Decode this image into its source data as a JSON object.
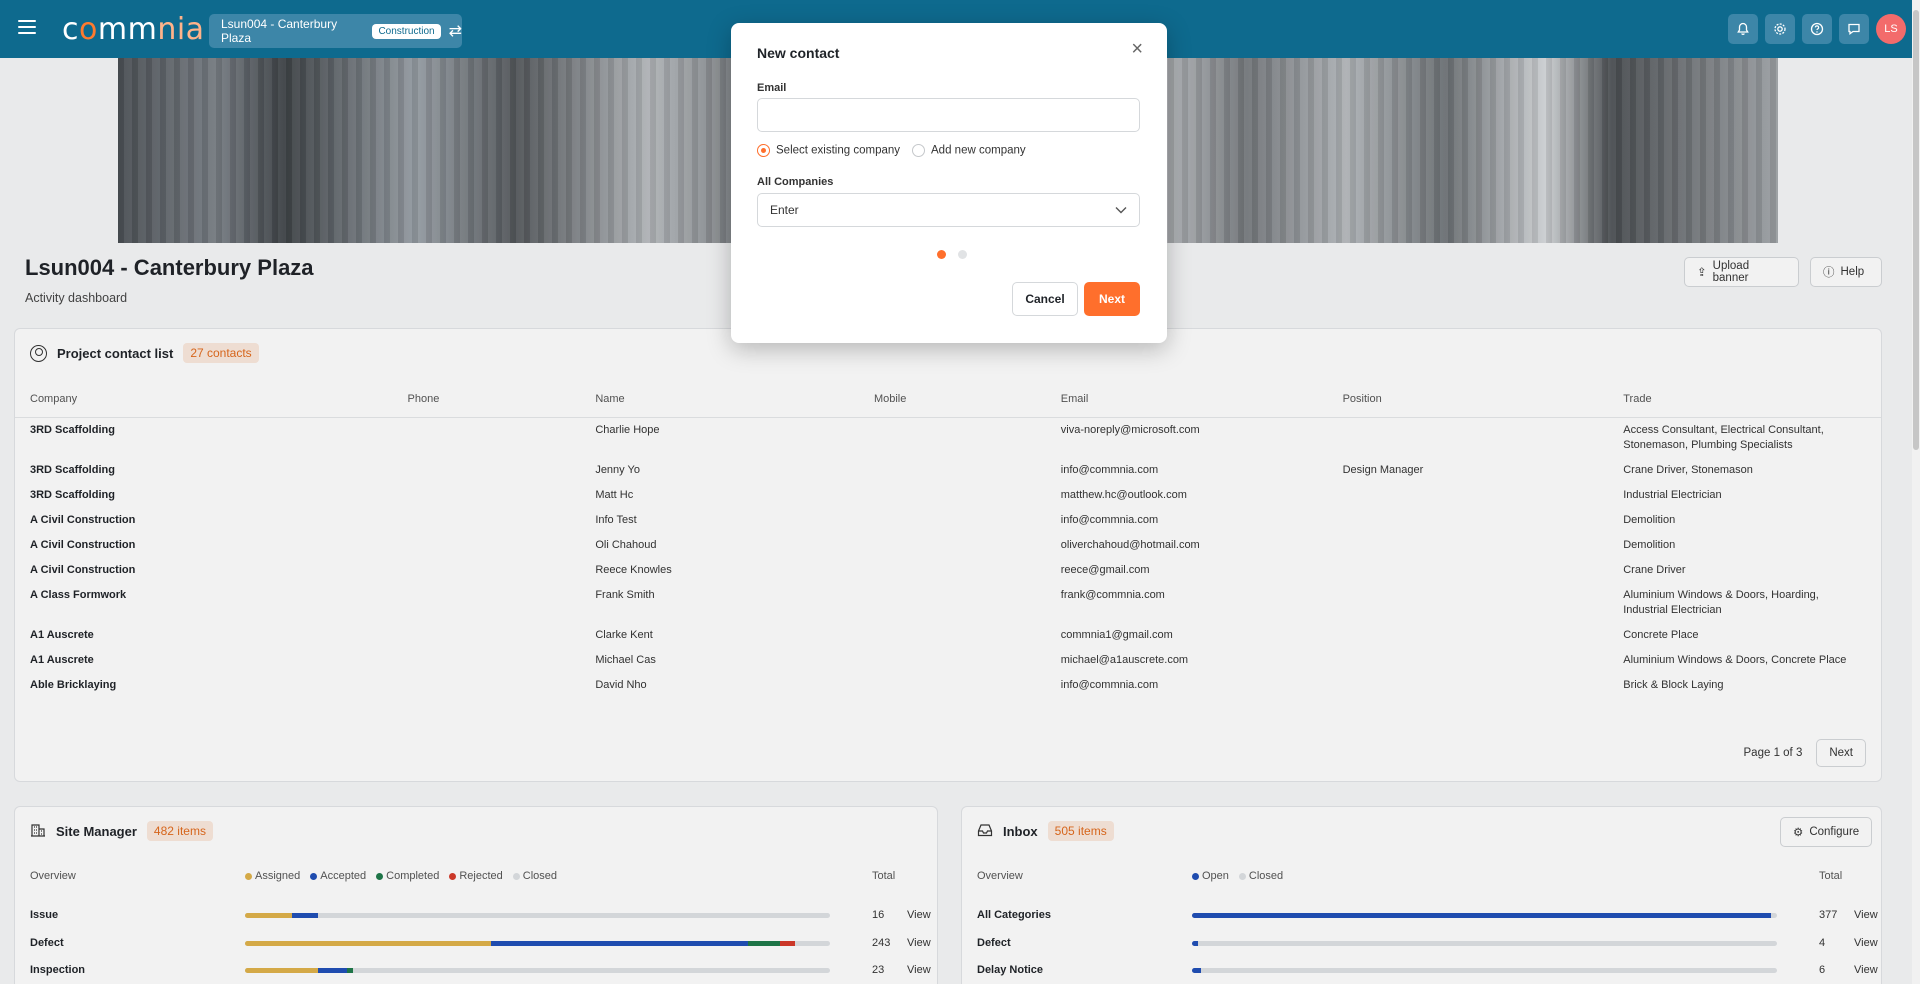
{
  "app": {
    "logo_text_c": "c",
    "logo_text_o": "o",
    "logo_text_mm": "mm",
    "logo_text_nia": "nia",
    "project_name": "Lsun004 - Canterbury Plaza",
    "project_badge": "Construction",
    "avatar_initials": "LS"
  },
  "colors": {
    "topbar": "#0e6a8e",
    "accent": "#ff6f2c"
  },
  "header": {
    "title": "Lsun004 - Canterbury Plaza",
    "subtitle": "Activity dashboard",
    "upload_banner": "Upload banner",
    "help": "Help"
  },
  "contacts": {
    "title": "Project contact list",
    "count": "27 contacts",
    "columns": [
      "Company",
      "Phone",
      "Name",
      "Mobile",
      "Email",
      "Position",
      "Trade"
    ],
    "rows": [
      [
        "3RD Scaffolding",
        "",
        "Charlie Hope",
        "",
        "viva-noreply@microsoft.com",
        "",
        "Access Consultant, Electrical Consultant, Stonemason, Plumbing Specialists"
      ],
      [
        "3RD Scaffolding",
        "",
        "Jenny Yo",
        "",
        "info@commnia.com",
        "Design Manager",
        "Crane Driver, Stonemason"
      ],
      [
        "3RD Scaffolding",
        "",
        "Matt Hc",
        "",
        "matthew.hc@outlook.com",
        "",
        "Industrial Electrician"
      ],
      [
        "A Civil Construction",
        "",
        "Info Test",
        "",
        "info@commnia.com",
        "",
        "Demolition"
      ],
      [
        "A Civil Construction",
        "",
        "Oli Chahoud",
        "",
        "oliverchahoud@hotmail.com",
        "",
        "Demolition"
      ],
      [
        "A Civil Construction",
        "",
        "Reece Knowles",
        "",
        "reece@gmail.com",
        "",
        "Crane Driver"
      ],
      [
        "A Class Formwork",
        "",
        "Frank Smith",
        "",
        "frank@commnia.com",
        "",
        "Aluminium Windows & Doors, Hoarding, Industrial Electrician"
      ],
      [
        "A1 Auscrete",
        "",
        "Clarke Kent",
        "",
        "commnia1@gmail.com",
        "",
        "Concrete Place"
      ],
      [
        "A1 Auscrete",
        "",
        "Michael Cas",
        "",
        "michael@a1auscrete.com",
        "",
        "Aluminium Windows & Doors, Concrete Place"
      ],
      [
        "Able Bricklaying",
        "",
        "David Nho",
        "",
        "info@commnia.com",
        "",
        "Brick & Block Laying"
      ]
    ],
    "page_label": "Page 1 of 3",
    "next_label": "Next"
  },
  "site_manager": {
    "title": "Site Manager",
    "count": "482 items",
    "overview": "Overview",
    "total": "Total",
    "legend": [
      {
        "label": "Assigned",
        "color": "#e0b24a"
      },
      {
        "label": "Accepted",
        "color": "#1f4fb8"
      },
      {
        "label": "Completed",
        "color": "#1e7a4a"
      },
      {
        "label": "Rejected",
        "color": "#d63a2a"
      },
      {
        "label": "Closed",
        "color": "#dfe2e5"
      }
    ],
    "rows": [
      {
        "label": "Issue",
        "total": "16",
        "view": "View",
        "segments": [
          0.08,
          0.045,
          0,
          0,
          0
        ]
      },
      {
        "label": "Defect",
        "total": "243",
        "view": "View",
        "segments": [
          0.42,
          0.44,
          0.055,
          0.025,
          0
        ]
      },
      {
        "label": "Inspection",
        "total": "23",
        "view": "View",
        "segments": [
          0.125,
          0.05,
          0.01,
          0,
          0
        ]
      }
    ]
  },
  "inbox": {
    "title": "Inbox",
    "count": "505 items",
    "configure": "Configure",
    "overview": "Overview",
    "total": "Total",
    "legend": [
      {
        "label": "Open",
        "color": "#1f4fb8"
      },
      {
        "label": "Closed",
        "color": "#dfe2e5"
      }
    ],
    "rows": [
      {
        "label": "All Categories",
        "total": "377",
        "view": "View",
        "segments": [
          0.99
        ]
      },
      {
        "label": "Defect",
        "total": "4",
        "view": "View",
        "segments": [
          0.01
        ]
      },
      {
        "label": "Delay Notice",
        "total": "6",
        "view": "View",
        "segments": [
          0.015
        ]
      }
    ]
  },
  "modal": {
    "title": "New contact",
    "email_label": "Email",
    "email_value": "",
    "radio_existing": "Select existing company",
    "radio_new": "Add new company",
    "companies_label": "All Companies",
    "companies_value": "Enter",
    "cancel": "Cancel",
    "next": "Next"
  }
}
